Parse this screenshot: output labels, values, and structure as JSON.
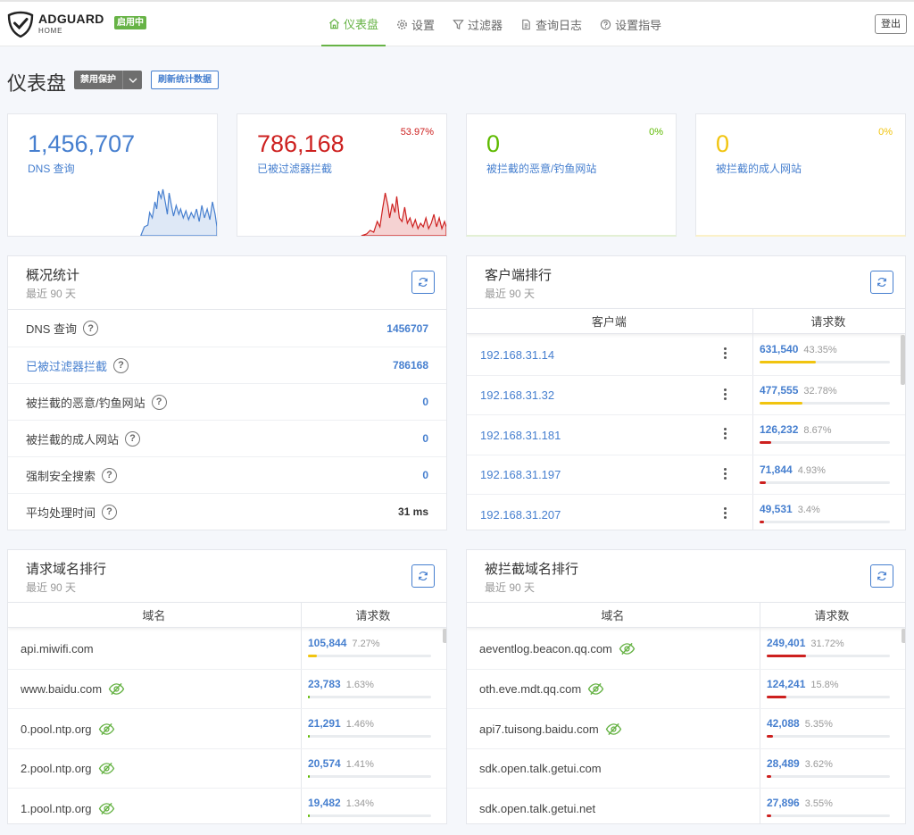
{
  "header": {
    "brand": "ADGUARD",
    "brand_sub": "HOME",
    "status": "启用中",
    "nav": [
      {
        "label": "仪表盘",
        "icon": "home-icon",
        "active": true
      },
      {
        "label": "设置",
        "icon": "gear-icon",
        "active": false
      },
      {
        "label": "过滤器",
        "icon": "filter-icon",
        "active": false
      },
      {
        "label": "查询日志",
        "icon": "document-icon",
        "active": false
      },
      {
        "label": "设置指导",
        "icon": "help-circle-icon",
        "active": false
      }
    ],
    "logout": "登出"
  },
  "page": {
    "title": "仪表盘",
    "disable_label": "禁用保护",
    "refresh_label": "刷新统计数据"
  },
  "cards": [
    {
      "value": "1,456,707",
      "label": "DNS 查询",
      "pct": "",
      "color": "#467fcf"
    },
    {
      "value": "786,168",
      "label": "已被过滤器拦截",
      "pct": "53.97%",
      "color": "#cd201f"
    },
    {
      "value": "0",
      "label": "被拦截的恶意/钓鱼网站",
      "pct": "0%",
      "color": "#5eba00"
    },
    {
      "value": "0",
      "label": "被拦截的成人网站",
      "pct": "0%",
      "color": "#f1c40f"
    }
  ],
  "overview": {
    "title": "概况统计",
    "subtitle": "最近 90 天",
    "rows": [
      {
        "name": "DNS 查询",
        "value": "1456707"
      },
      {
        "name": "已被过滤器拦截",
        "value": "786168"
      },
      {
        "name": "被拦截的恶意/钓鱼网站",
        "value": "0"
      },
      {
        "name": "被拦截的成人网站",
        "value": "0"
      },
      {
        "name": "强制安全搜索",
        "value": "0"
      },
      {
        "name": "平均处理时间",
        "value": "31 ms"
      }
    ]
  },
  "clients": {
    "title": "客户端排行",
    "subtitle": "最近 90 天",
    "col_client": "客户端",
    "col_requests": "请求数",
    "rows": [
      {
        "name": "192.168.31.14",
        "count": "631,540",
        "pct": "43.35%",
        "frac": 0.4335,
        "color": "#f1c40f"
      },
      {
        "name": "192.168.31.32",
        "count": "477,555",
        "pct": "32.78%",
        "frac": 0.3278,
        "color": "#f1c40f"
      },
      {
        "name": "192.168.31.181",
        "count": "126,232",
        "pct": "8.67%",
        "frac": 0.0867,
        "color": "#cd201f"
      },
      {
        "name": "192.168.31.197",
        "count": "71,844",
        "pct": "4.93%",
        "frac": 0.0493,
        "color": "#cd201f"
      },
      {
        "name": "192.168.31.207",
        "count": "49,531",
        "pct": "3.4%",
        "frac": 0.034,
        "color": "#cd201f"
      }
    ]
  },
  "queried": {
    "title": "请求域名排行",
    "subtitle": "最近 90 天",
    "col_domain": "域名",
    "col_requests": "请求数",
    "rows": [
      {
        "name": "api.miwifi.com",
        "count": "105,844",
        "pct": "7.27%",
        "frac": 0.0727,
        "color": "#f1c40f",
        "eye": false
      },
      {
        "name": "www.baidu.com",
        "count": "23,783",
        "pct": "1.63%",
        "frac": 0.0163,
        "color": "#5eba00",
        "eye": true
      },
      {
        "name": "0.pool.ntp.org",
        "count": "21,291",
        "pct": "1.46%",
        "frac": 0.0146,
        "color": "#5eba00",
        "eye": true
      },
      {
        "name": "2.pool.ntp.org",
        "count": "20,574",
        "pct": "1.41%",
        "frac": 0.0141,
        "color": "#5eba00",
        "eye": true
      },
      {
        "name": "1.pool.ntp.org",
        "count": "19,482",
        "pct": "1.34%",
        "frac": 0.0134,
        "color": "#5eba00",
        "eye": true
      }
    ]
  },
  "blocked": {
    "title": "被拦截域名排行",
    "subtitle": "最近 90 天",
    "col_domain": "域名",
    "col_requests": "请求数",
    "rows": [
      {
        "name": "aeventlog.beacon.qq.com",
        "count": "249,401",
        "pct": "31.72%",
        "frac": 0.3172,
        "color": "#cd201f",
        "eye": true
      },
      {
        "name": "oth.eve.mdt.qq.com",
        "count": "124,241",
        "pct": "15.8%",
        "frac": 0.158,
        "color": "#cd201f",
        "eye": true
      },
      {
        "name": "api7.tuisong.baidu.com",
        "count": "42,088",
        "pct": "5.35%",
        "frac": 0.0535,
        "color": "#cd201f",
        "eye": true
      },
      {
        "name": "sdk.open.talk.getui.com",
        "count": "28,489",
        "pct": "3.62%",
        "frac": 0.0362,
        "color": "#cd201f",
        "eye": false
      },
      {
        "name": "sdk.open.talk.getui.net",
        "count": "27,896",
        "pct": "3.55%",
        "frac": 0.0355,
        "color": "#cd201f",
        "eye": false
      }
    ]
  }
}
